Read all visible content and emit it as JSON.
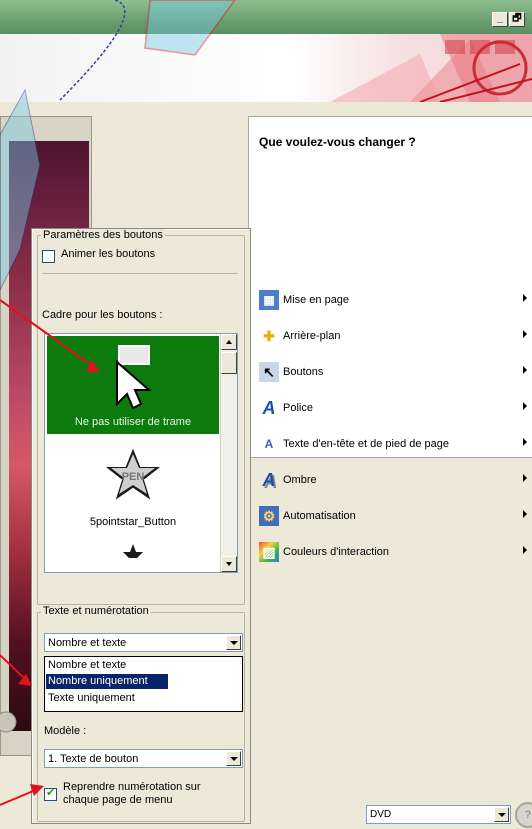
{
  "window": {
    "minimize_label": "_",
    "restore_label": "🗗"
  },
  "menu": {
    "title": "Que voulez-vous changer ?",
    "items": [
      {
        "label": "Mise en page",
        "icon": "layout-icon",
        "glyph": "▦"
      },
      {
        "label": "Arrière-plan",
        "icon": "background-icon",
        "glyph": "✚"
      },
      {
        "label": "Boutons",
        "icon": "buttons-icon",
        "glyph": "↖"
      },
      {
        "label": "Police",
        "icon": "font-icon",
        "glyph": "A"
      },
      {
        "label": "Texte d'en-tête et de pied de page",
        "icon": "header-footer-text-icon",
        "glyph": "A"
      },
      {
        "label": "Ombre",
        "icon": "shadow-icon",
        "glyph": "A"
      },
      {
        "label": "Automatisation",
        "icon": "automation-icon",
        "glyph": "⚙"
      },
      {
        "label": "Couleurs d'interaction",
        "icon": "interaction-colors-icon",
        "glyph": "▨"
      }
    ]
  },
  "panel": {
    "group_title": "Paramètres des boutons",
    "animate_label": "Animer les boutons",
    "frame_label": "Cadre pour les boutons :",
    "thumb1_label": "Ne pas utiliser de trame",
    "thumb2_label": "5pointstar_Button",
    "thumb2_badge": "PEN",
    "numbering_title": "Texte et numérotation",
    "numbering_value": "Nombre et texte",
    "options": [
      "Nombre et texte",
      "Nombre uniquement",
      "Texte uniquement"
    ],
    "model_label": "Modèle :",
    "model_value": "1. Texte de bouton",
    "restart_label_line1": "Reprendre numérotation sur",
    "restart_label_line2": "chaque page de menu"
  },
  "bottom": {
    "format_value": "DVD",
    "help_glyph": "?"
  },
  "colors": {
    "selected_thumb": "#0c7a0c",
    "annotation_red": "#e0121e",
    "selection_blue": "#0a246a"
  }
}
